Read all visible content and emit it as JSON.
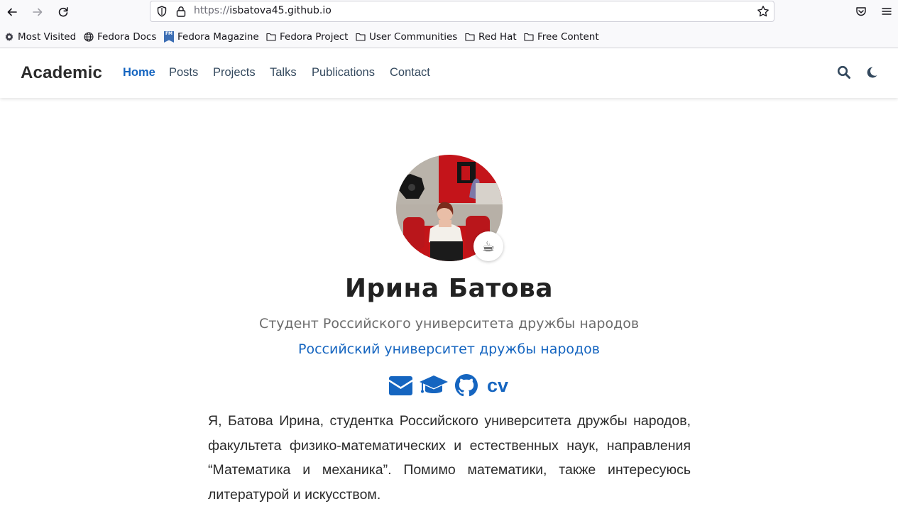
{
  "browser": {
    "url_scheme": "https://",
    "url_host": "isbatova45.github.io",
    "bookmarks": [
      {
        "label": "Most Visited",
        "icon": "gear-icon"
      },
      {
        "label": "Fedora Docs",
        "icon": "globe-icon"
      },
      {
        "label": "Fedora Magazine",
        "icon": "fedora-magazine-icon"
      },
      {
        "label": "Fedora Project",
        "icon": "folder-icon"
      },
      {
        "label": "User Communities",
        "icon": "folder-icon"
      },
      {
        "label": "Red Hat",
        "icon": "folder-icon"
      },
      {
        "label": "Free Content",
        "icon": "folder-icon"
      }
    ],
    "fm_badge": "FM"
  },
  "site": {
    "brand": "Academic",
    "nav": [
      {
        "label": "Home",
        "active": true
      },
      {
        "label": "Posts"
      },
      {
        "label": "Projects"
      },
      {
        "label": "Talks"
      },
      {
        "label": "Publications"
      },
      {
        "label": "Contact"
      }
    ],
    "accent_color": "#1565c0"
  },
  "profile": {
    "status_emoji": "☕",
    "name": "Ирина Батова",
    "role": "Студент Российского университета дружбы народов",
    "organization": "Российский университет дружбы народов",
    "social": [
      {
        "icon": "envelope-icon"
      },
      {
        "icon": "graduation-cap-icon"
      },
      {
        "icon": "github-icon"
      },
      {
        "label": "cv"
      }
    ],
    "bio": "Я, Батова Ирина, студентка Российского университета дружбы народов, факультета физико-математических и естественных наук, направления “Математика и механика”. Помимо математики, также интересуюсь литературой и искусством."
  }
}
